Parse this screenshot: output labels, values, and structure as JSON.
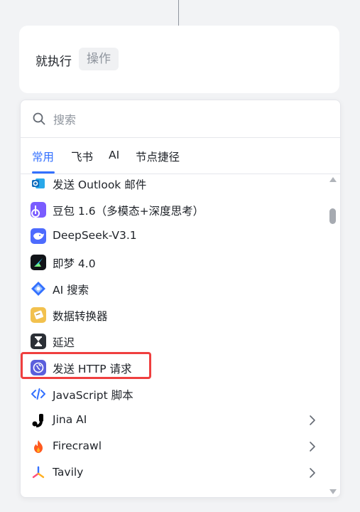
{
  "action_card": {
    "label": "就执行",
    "chip": "操作"
  },
  "search": {
    "placeholder": "搜索",
    "value": ""
  },
  "tabs": [
    {
      "label": "常用",
      "active": true
    },
    {
      "label": "飞书",
      "active": false
    },
    {
      "label": "AI",
      "active": false
    },
    {
      "label": "节点捷径",
      "active": false
    }
  ],
  "items": [
    {
      "label": "发送 Outlook 邮件",
      "icon": "outlook-icon"
    },
    {
      "label": "豆包 1.6（多模态+深度思考）",
      "icon": "doubao-icon"
    },
    {
      "label": "DeepSeek-V3.1",
      "icon": "deepseek-icon"
    },
    {
      "label": "即梦 4.0",
      "icon": "jimeng-icon"
    },
    {
      "label": "AI 搜索",
      "icon": "ai-search-icon"
    },
    {
      "label": "数据转换器",
      "icon": "data-converter-icon"
    },
    {
      "label": "延迟",
      "icon": "hourglass-icon"
    },
    {
      "label": "发送 HTTP 请求",
      "icon": "http-globe-icon",
      "highlighted": true
    },
    {
      "label": "JavaScript 脚本",
      "icon": "code-icon"
    },
    {
      "label": "Jina AI",
      "icon": "jina-icon",
      "has_submenu": true
    },
    {
      "label": "Firecrawl",
      "icon": "firecrawl-icon",
      "has_submenu": true
    },
    {
      "label": "Tavily",
      "icon": "tavily-icon",
      "has_submenu": true
    }
  ],
  "colors": {
    "accent": "#3370ff",
    "highlight": "#ef3f3f"
  }
}
